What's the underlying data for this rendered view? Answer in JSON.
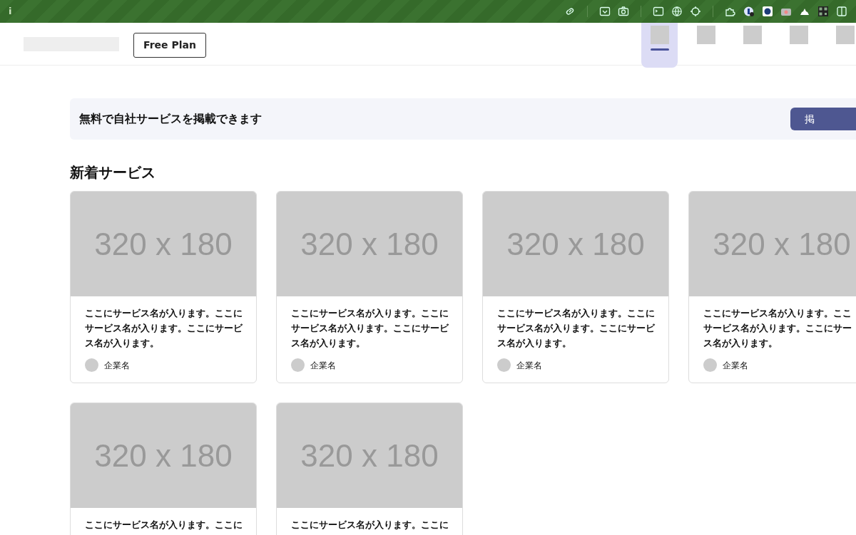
{
  "browser_bar": {
    "info": "i"
  },
  "header": {
    "plan_button": "Free Plan",
    "nav_tabs": [
      {
        "selected": true
      },
      {
        "selected": false
      },
      {
        "selected": false
      },
      {
        "selected": false
      },
      {
        "selected": false
      }
    ]
  },
  "banner": {
    "text": "無料で自社サービスを掲載できます",
    "button": "掲"
  },
  "section_title": "新着サービス",
  "cards": [
    {
      "image_label": "320 x 180",
      "title": "ここにサービス名が入ります。ここにサービス名が入ります。ここにサービス名が入ります。",
      "company": "企業名"
    },
    {
      "image_label": "320 x 180",
      "title": "ここにサービス名が入ります。ここにサービス名が入ります。ここにサービス名が入ります。",
      "company": "企業名"
    },
    {
      "image_label": "320 x 180",
      "title": "ここにサービス名が入ります。ここにサービス名が入ります。ここにサービス名が入ります。",
      "company": "企業名"
    },
    {
      "image_label": "320 x 180",
      "title_lines": [
        "ここにサービス名が入ります。ここ",
        "サービス名が入ります。ここにサー",
        "ス名が入ります。"
      ],
      "company": "企業名"
    },
    {
      "image_label": "320 x 180",
      "title": "ここにサービス名が入ります。ここに"
    },
    {
      "image_label": "320 x 180",
      "title": "ここにサービス名が入ります。ここに"
    }
  ]
}
